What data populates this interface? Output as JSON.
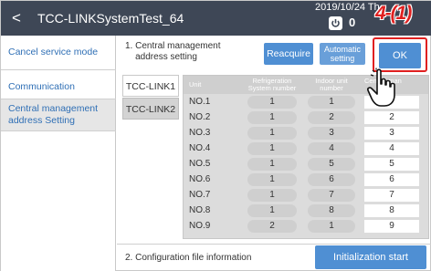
{
  "header": {
    "back_glyph": "<",
    "title": "TCC-LINKSystemTest_64",
    "datetime": "2019/10/24 Th",
    "power_count": "0",
    "annotation": "4-(1)"
  },
  "sidebar": {
    "items": [
      {
        "label": "Cancel service mode"
      },
      {
        "label": "Communication"
      },
      {
        "label": "Central management address Setting"
      }
    ]
  },
  "main": {
    "section1_title": "1. Central management\n    address setting",
    "buttons": {
      "reacquire": "Reacquire",
      "automatic": "Automatic\nsetting",
      "ok": "OK"
    },
    "tabs": [
      {
        "label": "TCC-LINK1"
      },
      {
        "label": "TCC-LINK2"
      }
    ],
    "table": {
      "headers": [
        "Unit",
        "Refrigeration\nSystem number",
        "Indoor unit\nnumber",
        "Central man"
      ],
      "rows": [
        {
          "unit": "NO.1",
          "refrigeration": "1",
          "indoor": "1",
          "central": ""
        },
        {
          "unit": "NO.2",
          "refrigeration": "1",
          "indoor": "2",
          "central": "2"
        },
        {
          "unit": "NO.3",
          "refrigeration": "1",
          "indoor": "3",
          "central": "3"
        },
        {
          "unit": "NO.4",
          "refrigeration": "1",
          "indoor": "4",
          "central": "4"
        },
        {
          "unit": "NO.5",
          "refrigeration": "1",
          "indoor": "5",
          "central": "5"
        },
        {
          "unit": "NO.6",
          "refrigeration": "1",
          "indoor": "6",
          "central": "6"
        },
        {
          "unit": "NO.7",
          "refrigeration": "1",
          "indoor": "7",
          "central": "7"
        },
        {
          "unit": "NO.8",
          "refrigeration": "1",
          "indoor": "8",
          "central": "8"
        },
        {
          "unit": "NO.9",
          "refrigeration": "2",
          "indoor": "1",
          "central": "9"
        }
      ]
    },
    "section2_title": "2. Configuration file information",
    "init_button": "Initialization start"
  },
  "icons": {
    "back": "chevron-left-icon",
    "power": "power-icon",
    "cursor": "hand-pointer-icon"
  },
  "colors": {
    "titlebar": "#3e4756",
    "button_blue": "#4f8fd3",
    "link_blue": "#2f6fb5",
    "annotation_red": "#e02020"
  }
}
